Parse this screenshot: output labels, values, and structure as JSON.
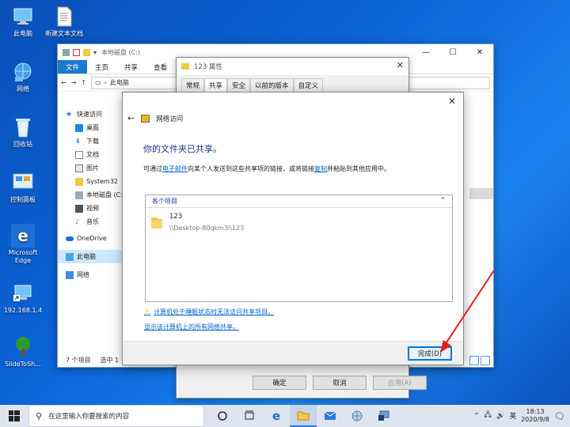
{
  "desktop": {
    "icons": [
      {
        "label": "此电脑"
      },
      {
        "label": "新建文本文档"
      },
      {
        "label": "网络"
      },
      {
        "label": "回收站"
      },
      {
        "label": "控制面板"
      },
      {
        "label": "Microsoft Edge"
      },
      {
        "label": "192.168.1.4"
      },
      {
        "label": "SlideToSh..."
      }
    ]
  },
  "explorer": {
    "title": "本地磁盘 (C:)",
    "ribbon_tabs": [
      "文件",
      "主页",
      "共享",
      "查看"
    ],
    "breadcrumb": "此电脑",
    "nav_items": [
      "快速访问",
      "桌面",
      "下载",
      "文档",
      "图片",
      "System32",
      "本地磁盘 (C:)",
      "视频",
      "音乐",
      "OneDrive",
      "此电脑",
      "网络"
    ],
    "status_count": "7 个项目",
    "status_selected": "选中 1"
  },
  "properties": {
    "title": "123 属性",
    "tabs": [
      "常规",
      "共享",
      "安全",
      "以前的版本",
      "自定义"
    ],
    "buttons": {
      "ok": "确定",
      "cancel": "取消",
      "apply": "应用(A)"
    }
  },
  "wizard": {
    "title": "网络访问",
    "heading": "你的文件夹已共享。",
    "desc_prefix": "可通过",
    "email_link": "电子邮件",
    "desc_middle": "向某个人发送到这些共享项的链接，或将链接",
    "copy_link": "复制",
    "desc_suffix": "并粘贴到其他应用中。",
    "list_header": "各个项目",
    "file_name": "123",
    "file_path": "\\\\Desktop-80qkm3i\\123",
    "warning_link": "计算机处于睡眠状态时无法访问共享项目。",
    "all_shares_link": "显示该计算机上的所有网络共享。",
    "done_button": "完成(D)"
  },
  "taskbar": {
    "search_placeholder": "在这里输入你要搜索的内容",
    "ime": "英",
    "time": "18:13",
    "date": "2020/9/8"
  }
}
